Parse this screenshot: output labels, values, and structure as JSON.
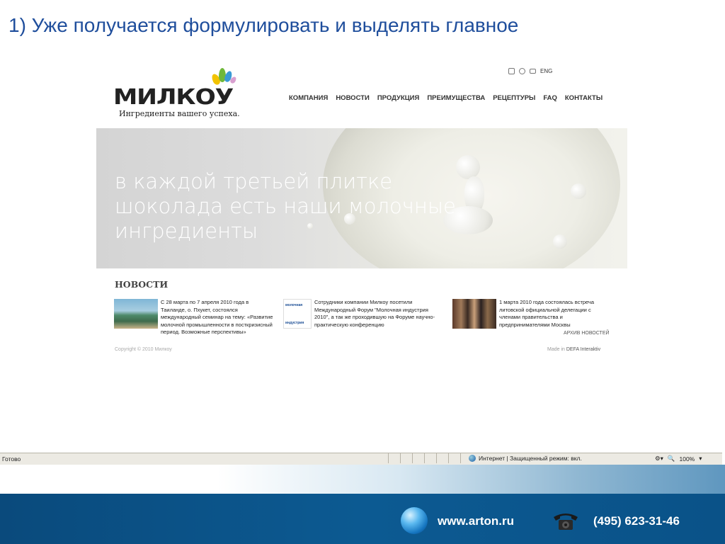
{
  "slide": {
    "title": "1) Уже получается формулировать и выделять главное"
  },
  "site": {
    "logo_text": "МИЛКОУ",
    "tagline": "Ингредиенты вашего успеха.",
    "util": {
      "lang": "ENG"
    },
    "nav": [
      "КОМПАНИЯ",
      "НОВОСТИ",
      "ПРОДУКЦИЯ",
      "ПРЕИМУЩЕСТВА",
      "РЕЦЕПТУРЫ",
      "FAQ",
      "КОНТАКТЫ"
    ],
    "hero_lines": [
      "в каждой третьей плитке",
      "шоколада есть наши молочные",
      "ингредиенты"
    ],
    "news_heading": "НОВОСТИ",
    "news": [
      {
        "text": "С 28 марта по 7 апреля 2010 года в Таиланде, о. Пхукет, состоялся международный семинар на тему: «Развитие молочной промышленности в посткризисный период. Возможные перспективы»"
      },
      {
        "text": "Сотрудники компании Милкоу посетили Международный Форум \"Молочная индустрия 2010\", а так же проходившую на Форуме научно-практическую конференцию",
        "thumb_text_1": "молочная",
        "thumb_text_2": "индустрия"
      },
      {
        "text": "1 марта 2010 года состоялась встреча литовской официальной делегации с членами правительства и предпринимателями Москвы"
      }
    ],
    "archive_link": "АРХИВ НОВОСТЕЙ",
    "copyright": "Copyright © 2010 Милкоу",
    "made_in_prefix": "Made in",
    "made_in_company": "DEFA Interaktiv"
  },
  "browser_status": {
    "ready": "Готово",
    "zone": "Интернет | Защищенный режим: вкл.",
    "zoom": "100%"
  },
  "footer": {
    "url": "www.arton.ru",
    "phone": "(495) 623-31-46"
  },
  "colors": {
    "title": "#1f4e9c",
    "footer_bg": "#0c5a92"
  }
}
